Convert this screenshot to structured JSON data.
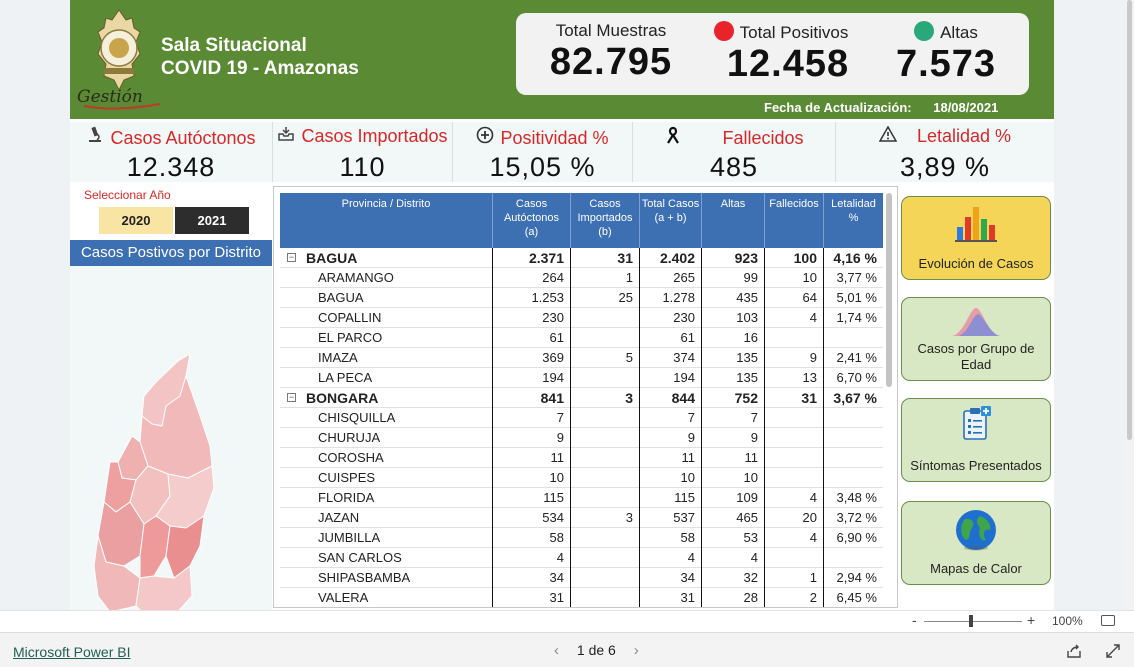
{
  "header": {
    "title_line1": "Sala Situacional",
    "title_line2": "COVID 19 - Amazonas",
    "logo_text": "Gestión",
    "update_label": "Fecha de Actualización:",
    "update_date": "18/08/2021"
  },
  "totals": [
    {
      "label": "Total Muestras",
      "value": "82.795",
      "dot_color": ""
    },
    {
      "label": "Total Positivos",
      "value": "12.458",
      "dot_color": "#e8232a"
    },
    {
      "label": "Altas",
      "value": "7.573",
      "dot_color": "#2aa87a"
    }
  ],
  "kpis": [
    {
      "label": "Casos Autóctonos",
      "value": "12.348",
      "icon": "microscope-icon"
    },
    {
      "label": "Casos Importados",
      "value": "110",
      "icon": "inbox-icon"
    },
    {
      "label": "Positividad %",
      "value": "15,05 %",
      "icon": "plus-circle-icon"
    },
    {
      "label": "Fallecidos",
      "value": "485",
      "icon": "mourning-ribbon-icon"
    },
    {
      "label": "Letalidad %",
      "value": "3,89 %",
      "icon": "warning-icon"
    }
  ],
  "year_selector": {
    "label": "Seleccionar Año",
    "options": [
      "2020",
      "2021"
    ],
    "selected": "2021"
  },
  "map": {
    "title": "Casos Postivos por Distrito"
  },
  "table": {
    "columns": [
      "Provincia / Distrito",
      "Casos Autóctonos (a)",
      "Casos Importados (b)",
      "Total Casos (a + b)",
      "Altas",
      "Fallecidos",
      "Letalidad %"
    ],
    "column_lines": [
      [
        "Provincia / Distrito"
      ],
      [
        "Casos",
        "Autóctonos",
        "(a)"
      ],
      [
        "Casos",
        "Importados",
        "(b)"
      ],
      [
        "Total Casos",
        "(a + b)"
      ],
      [
        "Altas"
      ],
      [
        "Fallecidos"
      ],
      [
        "Letalidad",
        "%"
      ]
    ],
    "rows": [
      {
        "level": "province",
        "cells": [
          "BAGUA",
          "2.371",
          "31",
          "2.402",
          "923",
          "100",
          "4,16 %"
        ]
      },
      {
        "level": "district",
        "cells": [
          "ARAMANGO",
          "264",
          "1",
          "265",
          "99",
          "10",
          "3,77 %"
        ]
      },
      {
        "level": "district",
        "cells": [
          "BAGUA",
          "1.253",
          "25",
          "1.278",
          "435",
          "64",
          "5,01 %"
        ]
      },
      {
        "level": "district",
        "cells": [
          "COPALLIN",
          "230",
          "",
          "230",
          "103",
          "4",
          "1,74 %"
        ]
      },
      {
        "level": "district",
        "cells": [
          "EL PARCO",
          "61",
          "",
          "61",
          "16",
          "",
          ""
        ]
      },
      {
        "level": "district",
        "cells": [
          "IMAZA",
          "369",
          "5",
          "374",
          "135",
          "9",
          "2,41 %"
        ]
      },
      {
        "level": "district",
        "cells": [
          "LA PECA",
          "194",
          "",
          "194",
          "135",
          "13",
          "6,70 %"
        ]
      },
      {
        "level": "province",
        "cells": [
          "BONGARA",
          "841",
          "3",
          "844",
          "752",
          "31",
          "3,67 %"
        ]
      },
      {
        "level": "district",
        "cells": [
          "CHISQUILLA",
          "7",
          "",
          "7",
          "7",
          "",
          ""
        ]
      },
      {
        "level": "district",
        "cells": [
          "CHURUJA",
          "9",
          "",
          "9",
          "9",
          "",
          ""
        ]
      },
      {
        "level": "district",
        "cells": [
          "COROSHA",
          "11",
          "",
          "11",
          "11",
          "",
          ""
        ]
      },
      {
        "level": "district",
        "cells": [
          "CUISPES",
          "10",
          "",
          "10",
          "10",
          "",
          ""
        ]
      },
      {
        "level": "district",
        "cells": [
          "FLORIDA",
          "115",
          "",
          "115",
          "109",
          "4",
          "3,48 %"
        ]
      },
      {
        "level": "district",
        "cells": [
          "JAZAN",
          "534",
          "3",
          "537",
          "465",
          "20",
          "3,72 %"
        ]
      },
      {
        "level": "district",
        "cells": [
          "JUMBILLA",
          "58",
          "",
          "58",
          "53",
          "4",
          "6,90 %"
        ]
      },
      {
        "level": "district",
        "cells": [
          "SAN CARLOS",
          "4",
          "",
          "4",
          "4",
          "",
          ""
        ]
      },
      {
        "level": "district",
        "cells": [
          "SHIPASBAMBA",
          "34",
          "",
          "34",
          "32",
          "1",
          "2,94 %"
        ]
      },
      {
        "level": "district",
        "cells": [
          "VALERA",
          "31",
          "",
          "31",
          "28",
          "2",
          "6,45 %"
        ]
      }
    ]
  },
  "nav_buttons": [
    {
      "label": "Evolución de Casos",
      "icon": "bar-chart-icon"
    },
    {
      "label": "Casos por Grupo de Edad",
      "icon": "distribution-curve-icon"
    },
    {
      "label": "Síntomas Presentados",
      "icon": "clipboard-icon"
    },
    {
      "label": "Mapas de Calor",
      "icon": "globe-icon"
    }
  ],
  "zoom": {
    "minus": "-",
    "plus": "+",
    "level": "100%"
  },
  "footer": {
    "brand_link": "Microsoft Power BI",
    "page_indicator": "1 de 6",
    "prev": "‹",
    "next": "›"
  },
  "colors": {
    "header_green": "#5a8a33",
    "table_header_blue": "#3d6fb3",
    "kpi_label_red": "#d62828",
    "nav_button_green": "#d9e8c4",
    "nav_button_yellow": "#f5d557"
  }
}
